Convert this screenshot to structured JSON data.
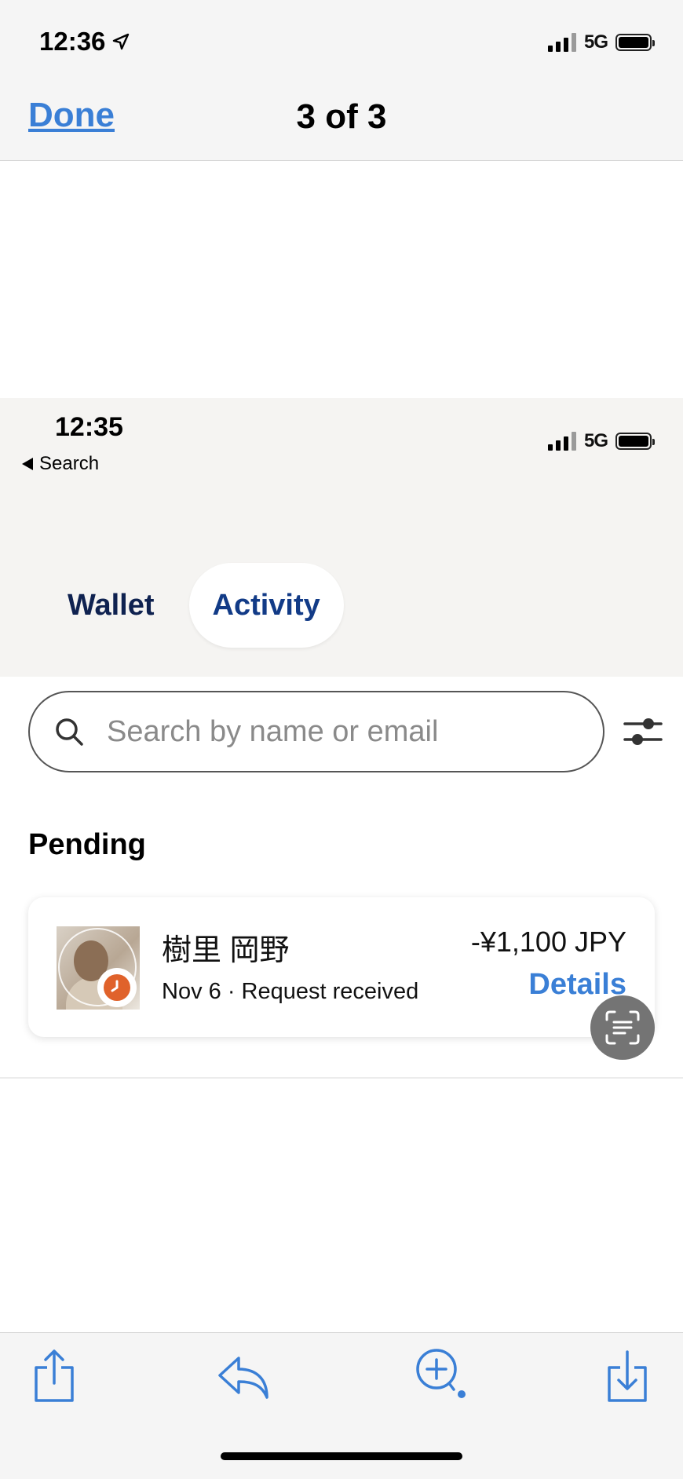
{
  "viewer": {
    "status_time": "12:36",
    "network": "5G",
    "done_label": "Done",
    "counter": "3 of 3"
  },
  "screenshot": {
    "status_time": "12:35",
    "back_label": "Search",
    "network": "5G",
    "tabs": [
      {
        "label": "Wallet",
        "active": false
      },
      {
        "label": "Activity",
        "active": true
      }
    ],
    "search": {
      "value": "",
      "placeholder": "Search by name or email"
    },
    "section_title": "Pending",
    "transaction": {
      "name": "樹里 岡野",
      "subtitle": "Nov 6 · Request received",
      "amount": "-¥1,100 JPY",
      "details_label": "Details",
      "status_color": "#e0622b"
    }
  },
  "toolbar": {
    "icons": [
      "share-icon",
      "reply-icon",
      "zoom-icon",
      "download-icon"
    ]
  },
  "colors": {
    "accent": "#3a7fd6",
    "tab_text": "#123b87"
  }
}
